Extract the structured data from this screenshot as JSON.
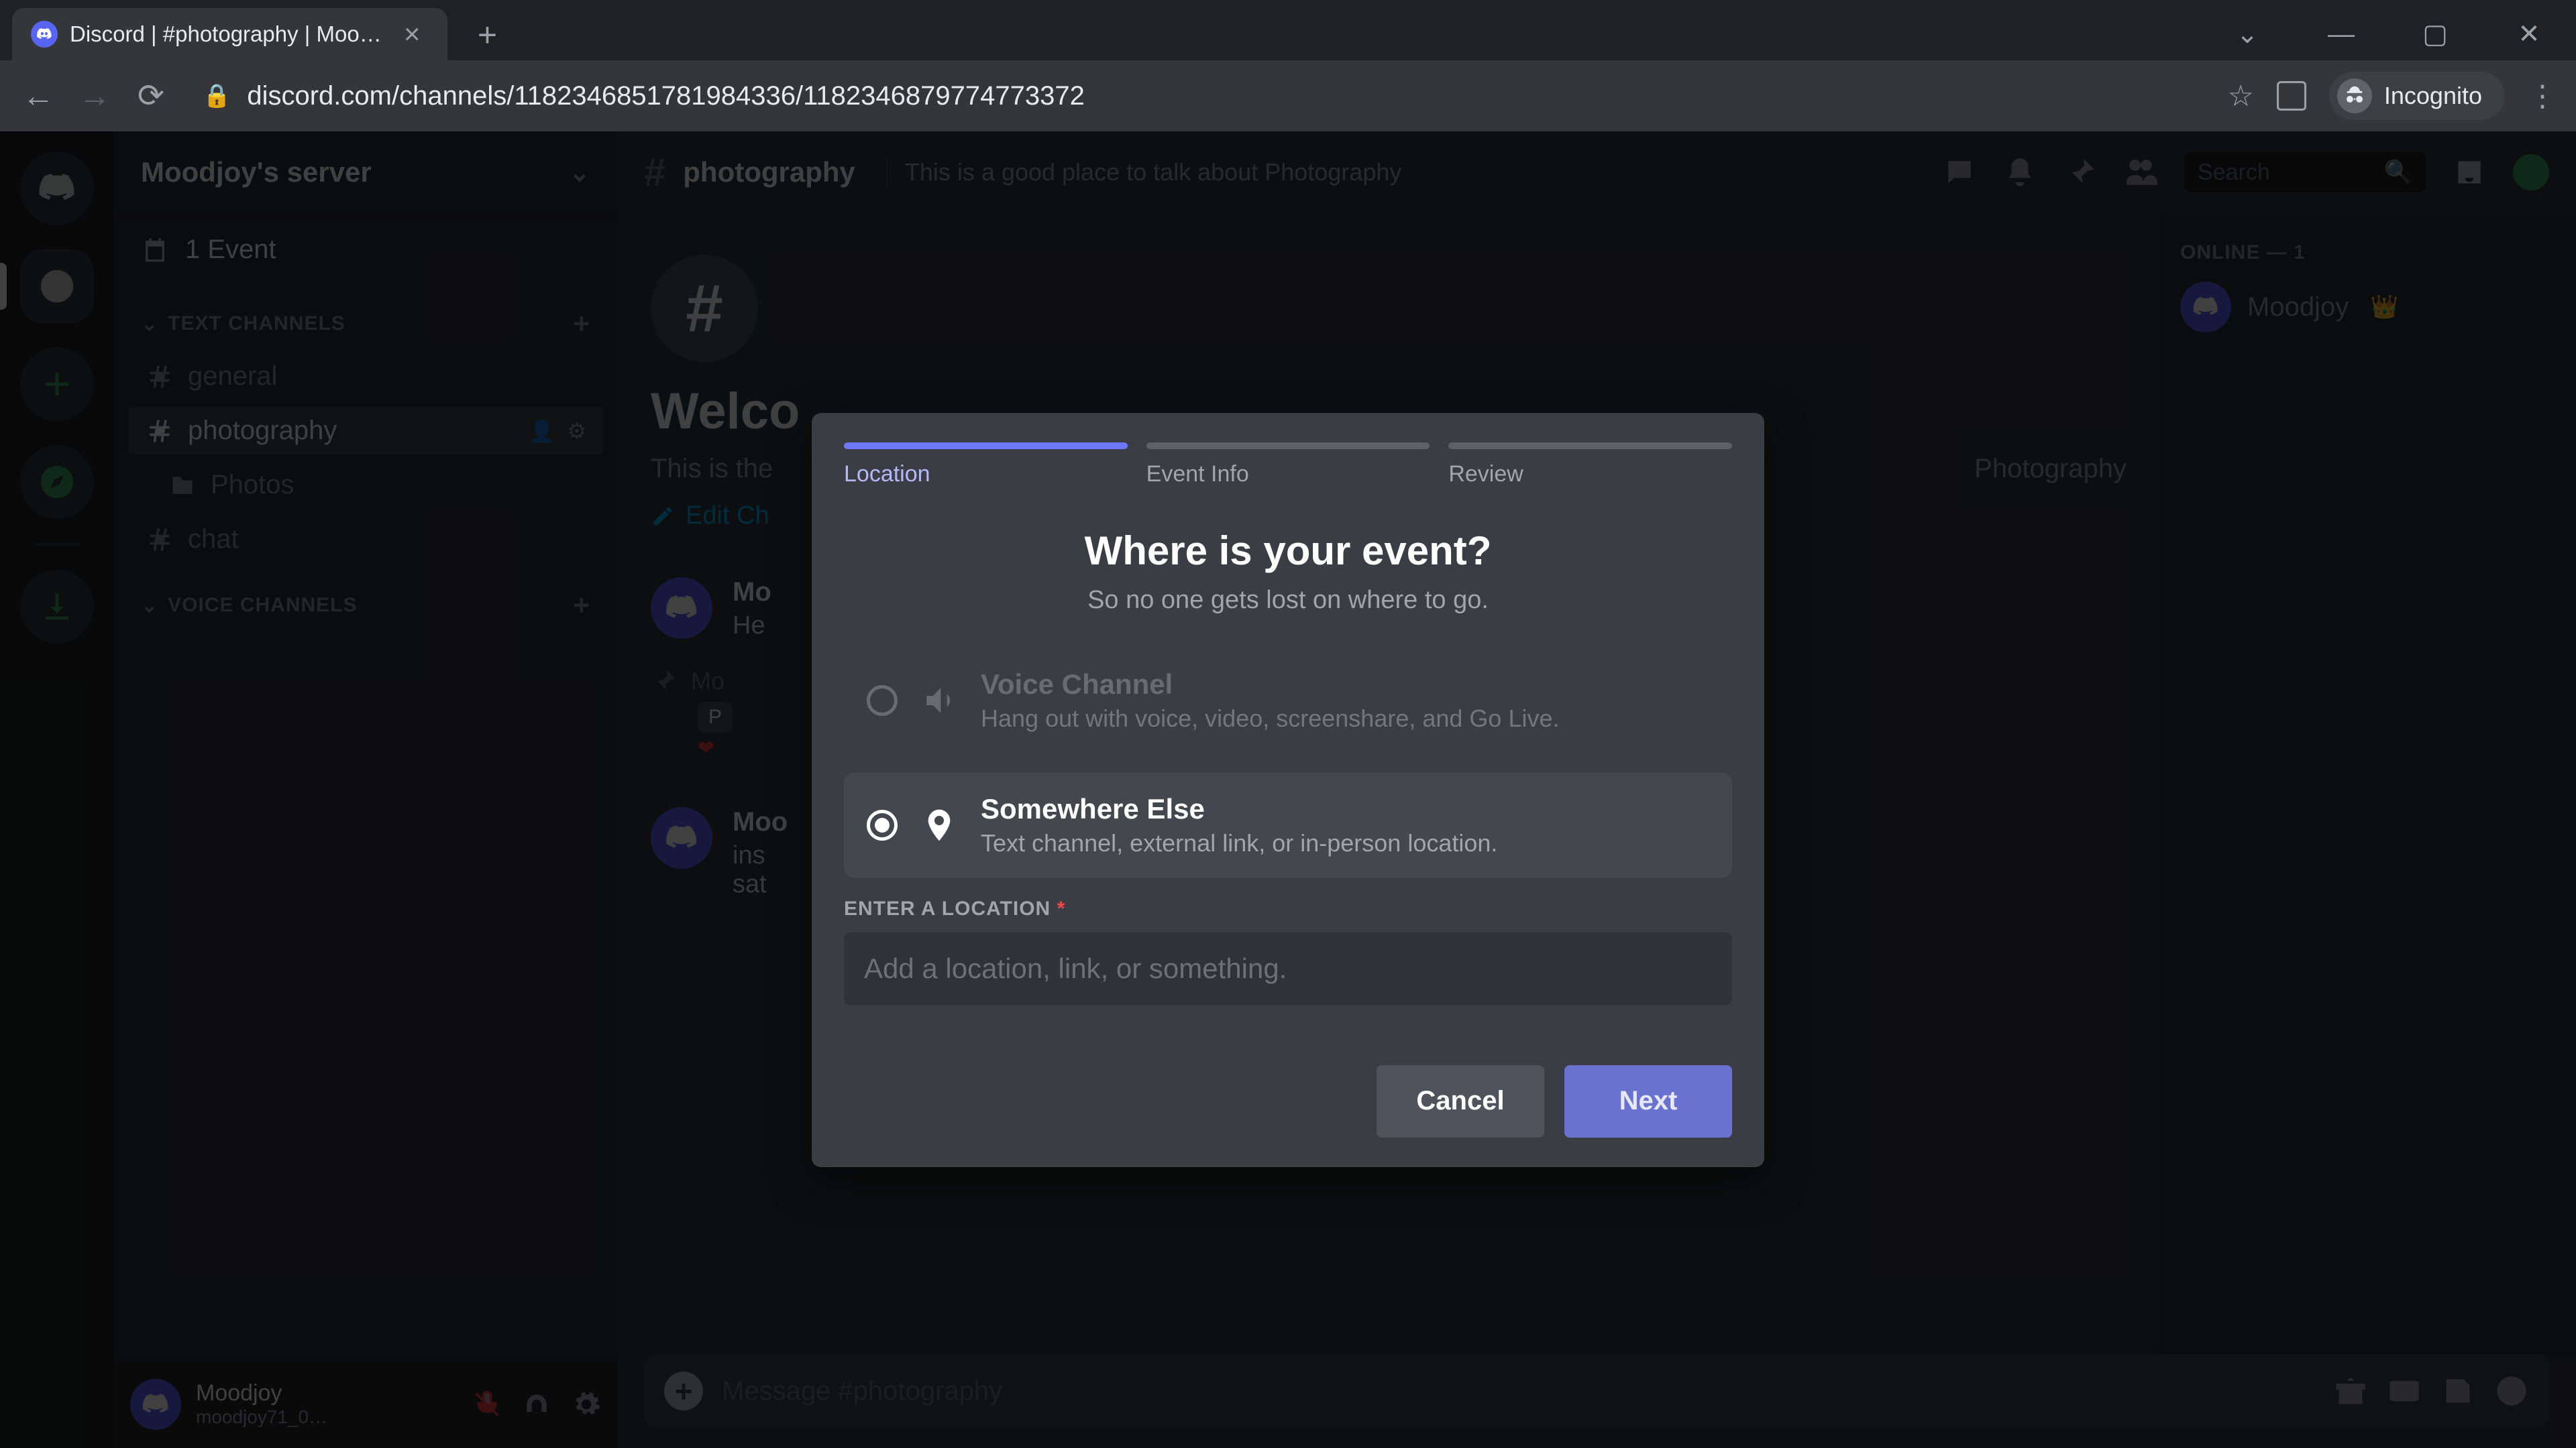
{
  "browser": {
    "tab_title": "Discord | #photography | Mood…",
    "url": "discord.com/channels/1182346851781984336/1182346879774773372",
    "incognito_label": "Incognito"
  },
  "server": {
    "name": "Moodjoy's server",
    "event_count_label": "1 Event"
  },
  "channel_list": {
    "text_header": "TEXT CHANNELS",
    "voice_header": "VOICE CHANNELS",
    "items": [
      {
        "name": "general"
      },
      {
        "name": "photography"
      },
      {
        "name": "Photos"
      },
      {
        "name": "chat"
      }
    ]
  },
  "user_panel": {
    "name": "Moodjoy",
    "discriminator": "moodjoy71_0…"
  },
  "chat": {
    "channel_name": "photography",
    "topic": "This is a good place to talk about Photography",
    "search_placeholder": "Search",
    "welcome_title": "Welco",
    "welcome_sub": "This is the",
    "welcome_sub_tail": "Photography",
    "edit_label": "Edit Ch",
    "msgs": [
      {
        "author": "Mo",
        "body": "He"
      },
      {
        "author": "Mo",
        "pin": "P"
      },
      {
        "author": "Moo",
        "body1": "ins",
        "body2": "sat"
      }
    ],
    "input_placeholder": "Message #photography"
  },
  "members": {
    "header": "ONLINE — 1",
    "items": [
      {
        "name": "Moodjoy"
      }
    ]
  },
  "modal": {
    "steps": [
      {
        "label": "Location"
      },
      {
        "label": "Event Info"
      },
      {
        "label": "Review"
      }
    ],
    "title": "Where is your event?",
    "subtitle": "So no one gets lost on where to go.",
    "options": [
      {
        "title": "Voice Channel",
        "desc": "Hang out with voice, video, screenshare, and Go Live."
      },
      {
        "title": "Somewhere Else",
        "desc": "Text channel, external link, or in-person location."
      }
    ],
    "location_label": "ENTER A LOCATION",
    "location_placeholder": "Add a location, link, or something.",
    "cancel": "Cancel",
    "next": "Next"
  }
}
